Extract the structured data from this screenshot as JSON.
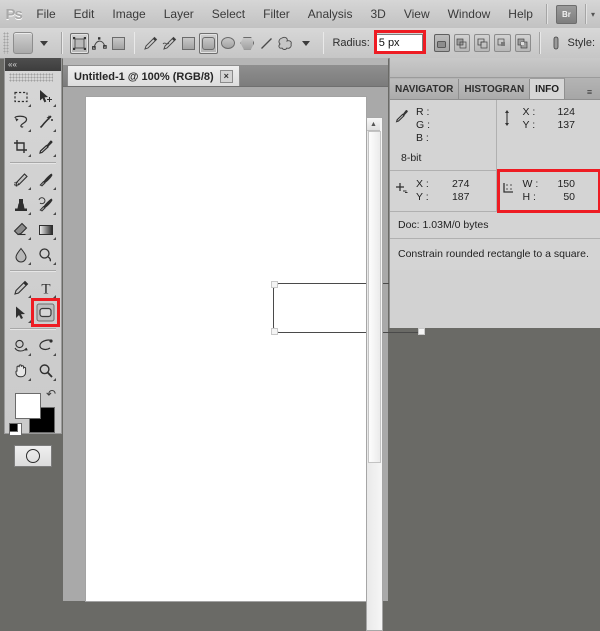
{
  "app": {
    "name": "Photoshop",
    "logo": "Ps"
  },
  "menubar": {
    "items": [
      {
        "label": "File"
      },
      {
        "label": "Edit"
      },
      {
        "label": "Image"
      },
      {
        "label": "Layer"
      },
      {
        "label": "Select"
      },
      {
        "label": "Filter"
      },
      {
        "label": "Analysis"
      },
      {
        "label": "3D"
      },
      {
        "label": "View"
      },
      {
        "label": "Window"
      },
      {
        "label": "Help"
      }
    ],
    "bridge_button": "Br",
    "arrange_arrow": "▾"
  },
  "options_bar": {
    "tool_preset_label": "tool-preset",
    "mode_buttons": [
      "shape-layers",
      "paths",
      "fill-pixels"
    ],
    "shape_tools": [
      "pen",
      "freeform-pen",
      "rectangle",
      "rounded-rectangle",
      "ellipse",
      "polygon",
      "line",
      "custom-shape"
    ],
    "active_shape_tool": "rounded-rectangle",
    "radius_label": "Radius:",
    "radius_value": "5 px",
    "radius_highlighted": true,
    "boolean_buttons": [
      "new-shape-layer",
      "add-to-shape-area",
      "subtract-from-shape-area",
      "intersect-shape-areas",
      "exclude-overlapping-shape-areas"
    ],
    "style_label": "Style:"
  },
  "toolbox": {
    "collapse_label": "««",
    "tools": [
      {
        "name": "marquee-tool",
        "row": 0
      },
      {
        "name": "move-tool",
        "row": 0
      },
      {
        "name": "lasso-tool",
        "row": 1
      },
      {
        "name": "magic-wand-tool",
        "row": 1
      },
      {
        "name": "crop-tool",
        "row": 2
      },
      {
        "name": "eyedropper-tool",
        "row": 2
      },
      {
        "name": "healing-brush-tool",
        "row": 3
      },
      {
        "name": "brush-tool",
        "row": 3
      },
      {
        "name": "clone-stamp-tool",
        "row": 4
      },
      {
        "name": "history-brush-tool",
        "row": 4
      },
      {
        "name": "eraser-tool",
        "row": 5
      },
      {
        "name": "gradient-tool",
        "row": 5
      },
      {
        "name": "blur-tool",
        "row": 6
      },
      {
        "name": "dodge-tool",
        "row": 6
      },
      {
        "name": "pen-tool",
        "row": 7
      },
      {
        "name": "type-tool",
        "row": 7
      },
      {
        "name": "path-selection-tool",
        "row": 8
      },
      {
        "name": "rounded-rectangle-tool",
        "row": 8,
        "selected": true,
        "highlighted": true
      },
      {
        "name": "3d-rotate-tool",
        "row": 9
      },
      {
        "name": "3d-orbit-tool",
        "row": 9
      },
      {
        "name": "hand-tool",
        "row": 10
      },
      {
        "name": "zoom-tool",
        "row": 10
      }
    ],
    "foreground_color": "#ffffff",
    "background_color": "#000000",
    "quick_mask_label": "quick-mask-mode"
  },
  "document": {
    "tab_title": "Untitled-1 @ 100% (RGB/8)",
    "close_glyph": "×",
    "canvas_background": "#ffffff",
    "shape": {
      "name": "rounded-rectangle-shape",
      "width": 150,
      "height": 50,
      "corner_radius": 5
    }
  },
  "right_panel": {
    "tabs": [
      {
        "label": "NAVIGATOR",
        "active": false
      },
      {
        "label": "HISTOGRAN",
        "active": false
      },
      {
        "label": "INFO",
        "active": true
      }
    ],
    "menu_glyph": "≡",
    "info": {
      "color_readout": {
        "icon": "eyedropper-icon",
        "rows": [
          {
            "key": "R :",
            "value": ""
          },
          {
            "key": "G :",
            "value": ""
          },
          {
            "key": "B :",
            "value": ""
          }
        ],
        "bit_depth": "8-bit"
      },
      "secondary_readout": {
        "icon": "crosshair-vertical-icon",
        "rows": [
          {
            "key": "X :",
            "value": "124"
          },
          {
            "key": "Y :",
            "value": "137"
          }
        ]
      },
      "pointer_position": {
        "icon": "pointer-crosshair-icon",
        "rows": [
          {
            "key": "X :",
            "value": "274"
          },
          {
            "key": "Y :",
            "value": "187"
          }
        ]
      },
      "selection_size": {
        "icon": "marquee-corner-icon",
        "highlighted": true,
        "rows": [
          {
            "key": "W :",
            "value": "150"
          },
          {
            "key": "H :",
            "value": "50"
          }
        ]
      },
      "doc_info": "Doc: 1.03M/0 bytes",
      "hint": "Constrain rounded rectangle to a square."
    }
  },
  "highlight_color": "#ee1c23"
}
